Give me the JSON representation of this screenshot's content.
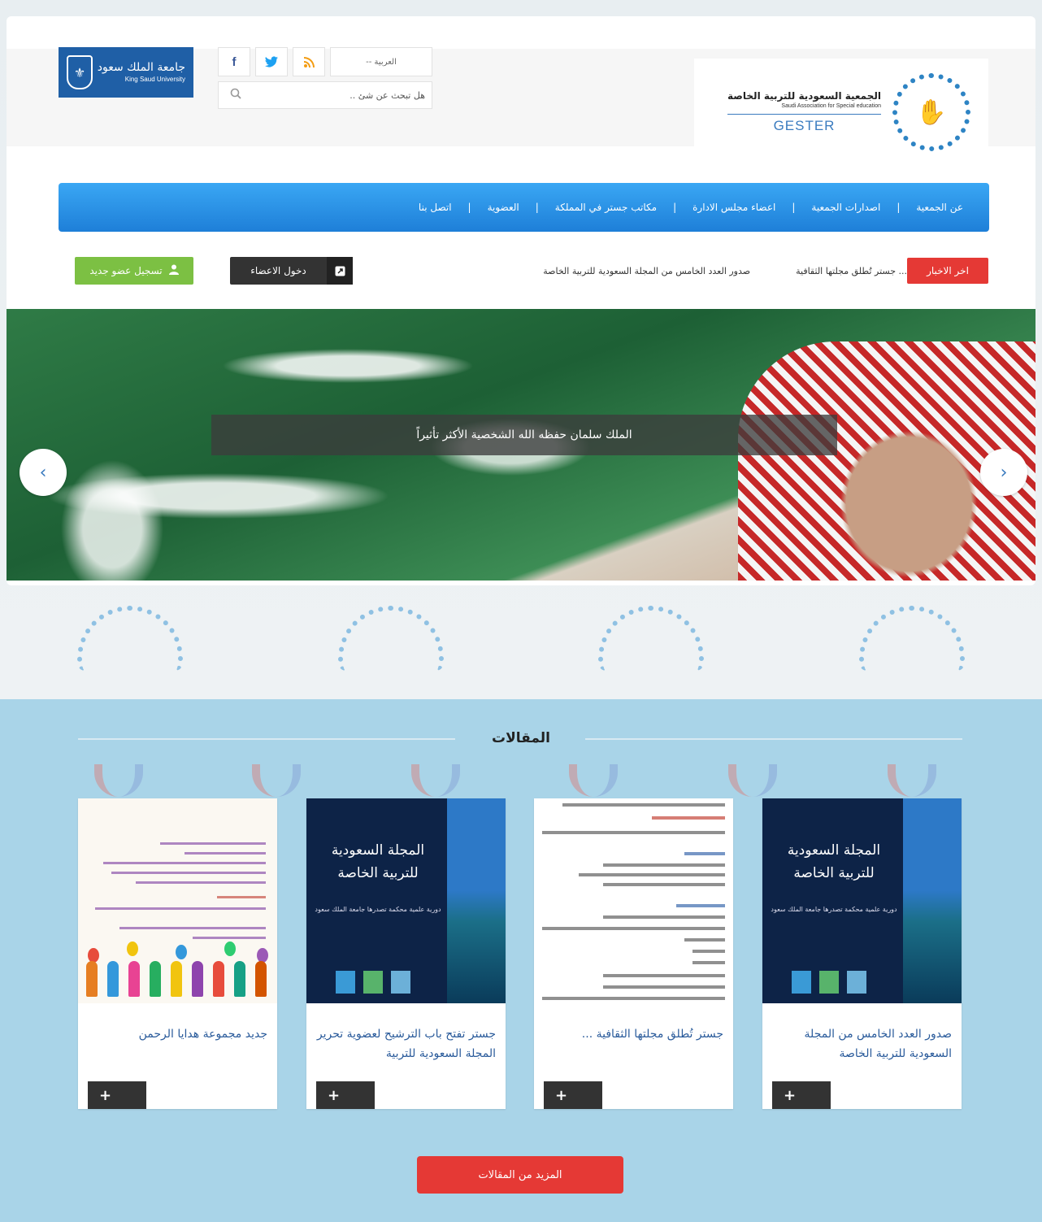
{
  "header": {
    "university_name_ar": "جامعة الملك سعود",
    "university_name_en": "King Saud University",
    "social": [
      {
        "name": "facebook",
        "glyph": "f",
        "color": "#3b5998"
      },
      {
        "name": "twitter",
        "glyph": "🐦",
        "color": "#1da1f2"
      },
      {
        "name": "rss",
        "glyph": "☰",
        "color": "#f39c12"
      }
    ],
    "language": "-- العربية",
    "search_placeholder": "هل تبحث عن شئ ..",
    "association_name_ar": "الجمعية السعودية للتربية الخاصة",
    "association_name_en": "Saudi Association for Special education",
    "association_short": "GESTER"
  },
  "nav": {
    "items": [
      "عن الجمعية",
      "اصدارات الجمعية",
      "اعضاء مجلس الادارة",
      "مكاتب جستر في المملكة",
      "العضوية",
      "اتصل بنا"
    ],
    "separator": "|",
    "color": "#2a8ee6"
  },
  "news": {
    "label": "اخر الاخبار",
    "items": [
      "صدور العدد الخامس من المجلة السعودية للتربية الخاصة",
      "جستر تُطلق مجلتها الثقافية ..."
    ]
  },
  "buttons": {
    "login": "دخول الاعضاء",
    "register": "تسجيل عضو جديد"
  },
  "hero": {
    "caption": "الملك سلمان حفظه الله الشخصية الأكثر تأثيراً",
    "prev_arrow": "‹",
    "next_arrow": "›"
  },
  "articles": {
    "title": "المقالات",
    "cards": [
      {
        "title": "صدور العدد الخامس من المجلة السعودية للتربية الخاصة",
        "image": "journal",
        "more": "+"
      },
      {
        "title": "جستر تُطلق مجلتها الثقافية ...",
        "image": "doc",
        "more": "+"
      },
      {
        "title": "جستر تفتح باب الترشيح لعضوية تحرير المجلة السعودية للتربية",
        "image": "journal",
        "more": "+"
      },
      {
        "title": "جديد مجموعة هدايا الرحمن",
        "image": "kids",
        "more": "+"
      }
    ],
    "journal_title": "المجلة السعودية للتربية الخاصة",
    "journal_sub": "دورية علمية محكمة تصدرها جامعة الملك سعود",
    "more_button": "المزيد من المقالات"
  },
  "colors": {
    "accent_red": "#e53935",
    "accent_green": "#7cc043",
    "nav_blue": "#2a8ee6",
    "section_bg": "#a9d4e8"
  }
}
